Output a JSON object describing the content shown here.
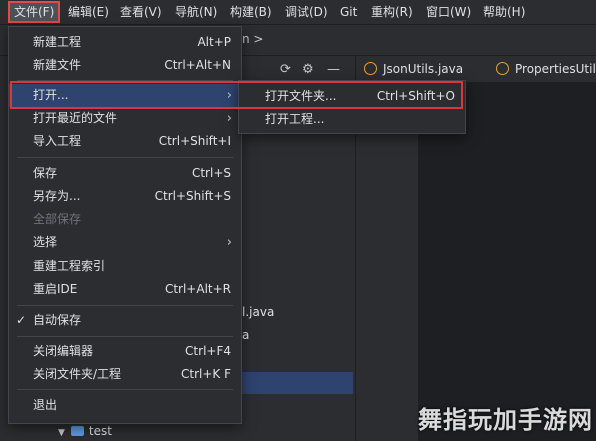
{
  "menubar": {
    "items": [
      "文件(F)",
      "编辑(E)",
      "查看(V)",
      "导航(N)",
      "构建(B)",
      "调试(D)",
      "Git",
      "重构(R)",
      "窗口(W)",
      "帮助(H)"
    ]
  },
  "breadcrumb": {
    "tail": "n >"
  },
  "tabs": [
    {
      "label": "JsonUtils.java"
    },
    {
      "label": "PropertiesUtil..."
    }
  ],
  "project_tree": {
    "visible_fragments": [
      "l.java",
      "a"
    ],
    "test_folder": "test"
  },
  "file_menu": {
    "items": [
      {
        "label": "新建工程",
        "shortcut": "Alt+P"
      },
      {
        "label": "新建文件",
        "shortcut": "Ctrl+Alt+N"
      },
      {
        "label": "打开...",
        "submenu": true
      },
      {
        "label": "打开最近的文件",
        "submenu": true
      },
      {
        "label": "导入工程",
        "shortcut": "Ctrl+Shift+I"
      },
      {
        "label": "保存",
        "shortcut": "Ctrl+S"
      },
      {
        "label": "另存为...",
        "shortcut": "Ctrl+Shift+S"
      },
      {
        "label": "全部保存",
        "disabled": true
      },
      {
        "label": "选择",
        "submenu": true
      },
      {
        "label": "重建工程索引"
      },
      {
        "label": "重启IDE",
        "shortcut": "Ctrl+Alt+R"
      },
      {
        "label": "自动保存",
        "checked": true
      },
      {
        "label": "关闭编辑器",
        "shortcut": "Ctrl+F4"
      },
      {
        "label": "关闭文件夹/工程",
        "shortcut": "Ctrl+K F"
      },
      {
        "label": "退出"
      }
    ]
  },
  "open_submenu": {
    "items": [
      {
        "label": "打开文件夹...",
        "shortcut": "Ctrl+Shift+O"
      },
      {
        "label": "打开工程..."
      }
    ]
  },
  "watermark": "舞指玩加手游网",
  "colors": {
    "accent_highlight": "#2e436e",
    "annotation_red": "#d9373f",
    "menu_bg": "#2b2d30"
  }
}
